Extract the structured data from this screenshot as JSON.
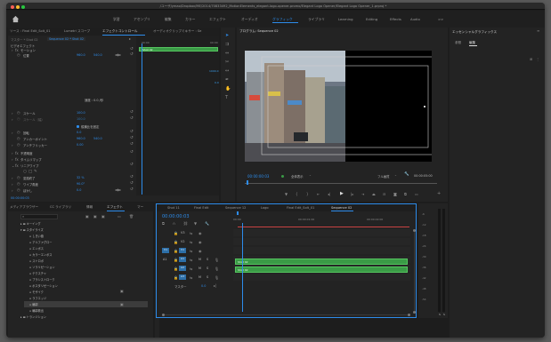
{
  "window_title": "/ユーザ/ymao/Dropbox/ME/2014/70833492_MotionElements_elegant-logo-opener-promo/Elegant Logo Opener/Elegant Logo Opener_1.prproj *",
  "workspaces": [
    "学習",
    "アセンブリ",
    "編集",
    "カラー",
    "エフェクト",
    "オーディオ",
    "グラフィック",
    "ライブラリ",
    "Learning",
    "Editing",
    "Effects",
    "Audio"
  ],
  "active_workspace": "グラフィック",
  "more_icon": ">>",
  "source_tabs": [
    "ソース : Final Edit_Solt_01",
    "Lumetri スコープ",
    "エフェクトコントロール",
    "オーディオクリップミキサー : Se"
  ],
  "effect_controls": {
    "master_label": "マスター * Shot 02",
    "seq_label": "Sequence 02 * Shot 02",
    "video_effects": "ビデオエフェクト",
    "clip_name": "Shot 02",
    "rows": [
      {
        "name": "モーション",
        "value": "",
        "value2": ""
      },
      {
        "name": "位置",
        "value": "960.0",
        "value2": "540.0"
      },
      {
        "name": "",
        "value": "",
        "value2": ""
      },
      {
        "name": "",
        "value": "",
        "value2": ""
      },
      {
        "name": "スケール",
        "value": "100.0",
        "value2": ""
      },
      {
        "name": "スケール（幅）",
        "value": "100.0",
        "value2": ""
      },
      {
        "name": "",
        "value": "縦横比を固定",
        "value2": ""
      },
      {
        "name": "回転",
        "value": "0.0",
        "value2": ""
      },
      {
        "name": "アンカーポイント",
        "value": "960.0",
        "value2": "540.0"
      },
      {
        "name": "アンチフリッカー",
        "value": "0.00",
        "value2": ""
      },
      {
        "name": "不透明度",
        "value": "",
        "value2": ""
      },
      {
        "name": "タイムリマップ",
        "value": "",
        "value2": ""
      },
      {
        "name": "リニアワイプ",
        "value": "",
        "value2": ""
      },
      {
        "name": "",
        "value": "",
        "value2": ""
      },
      {
        "name": "変換終了",
        "value": "32 %",
        "value2": ""
      },
      {
        "name": "ワイプ角度",
        "value": "90.0°",
        "value2": ""
      },
      {
        "name": "ぼかし",
        "value": "0.0",
        "value2": ""
      }
    ],
    "speed_text": "速度 : 0.0 /秒",
    "time_value": "1000.0",
    "time_value2": "0.0",
    "current_time": "00:00:00:03"
  },
  "program": {
    "tab": "プログラム: Sequence 02",
    "timecode": "00:00:00:03",
    "fit": "全体表示",
    "quality": "フル画質",
    "duration": "00:00:05:00"
  },
  "essential_graphics": {
    "title": "エッセンシャルグラフィックス",
    "tabs": [
      "参照",
      "編集"
    ],
    "active_tab": "編集"
  },
  "project_tabs": [
    "メディアブラウザー",
    "CC ライブラリ",
    "情報",
    "エフェクト",
    "マー"
  ],
  "effects_tree": [
    "キーイング",
    "スタイライズ",
    "しきい値",
    "アルファグロー",
    "エンボス",
    "カラーエンボス",
    "ストロボ",
    "ソラリゼーション",
    "テクスチャ",
    "ブラシストローク",
    "ポスタリゼーション",
    "モザイク",
    "ラフエッジ",
    "輪郭",
    "輪郭検出",
    "トランジション"
  ],
  "timeline": {
    "tabs": [
      "Shot 11",
      "Final Edit",
      "Sequence 12",
      "Logo",
      "Final Edit_Solt_01",
      "Sequence 02"
    ],
    "active_tab": "Sequence 02",
    "timecode": "00:00:00:03",
    "ruler": [
      "00:00",
      "00:00:01:00",
      "00:00:02:00"
    ],
    "video_tracks": [
      "V3",
      "V2",
      "V1"
    ],
    "audio_tracks": [
      "A1",
      "A2",
      "A3"
    ],
    "master": "マスター",
    "master_value": "0.0",
    "clips": [
      "Shot 02",
      "Shot 02"
    ]
  },
  "meter_ticks": [
    "-6",
    "-12",
    "-18",
    "-24",
    "-30",
    "-36",
    "-42",
    "-48",
    "-54"
  ]
}
